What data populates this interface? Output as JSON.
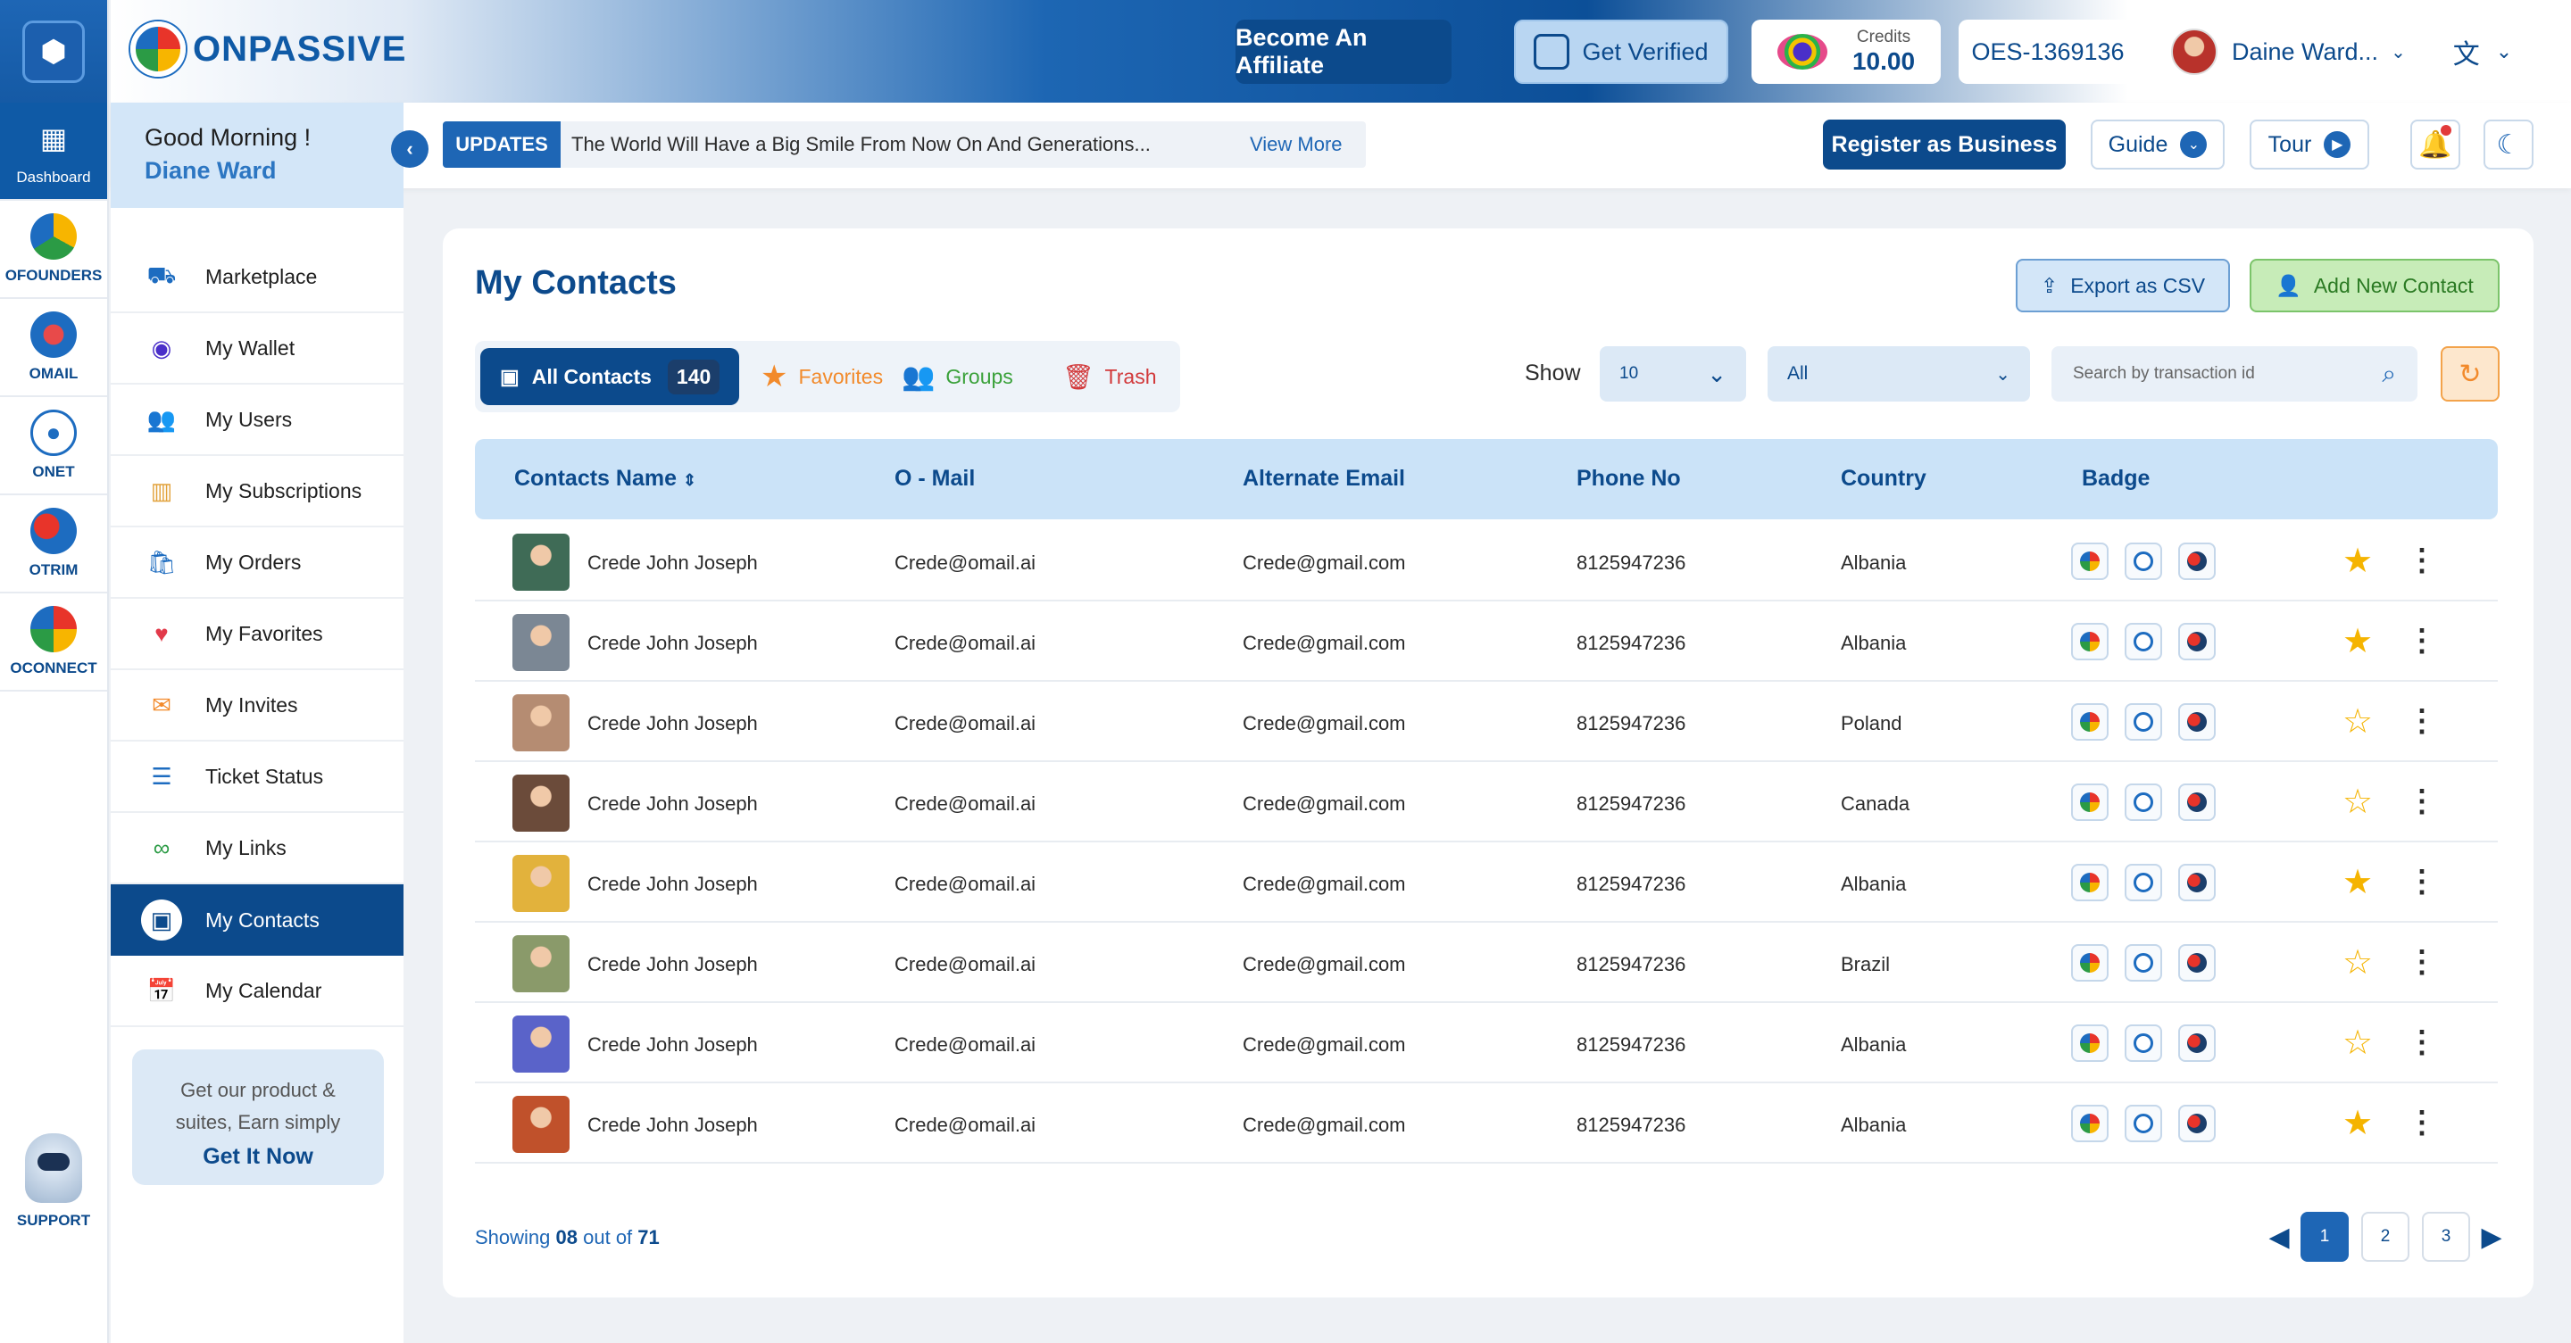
{
  "rail": {
    "items": [
      {
        "label": "Dashboard",
        "icon": "grid-icon"
      },
      {
        "label": "OFOUNDERS",
        "icon": "ofounders-icon"
      },
      {
        "label": "OMAIL",
        "icon": "omail-icon"
      },
      {
        "label": "ONET",
        "icon": "onet-icon"
      },
      {
        "label": "OTRIM",
        "icon": "otrim-icon"
      },
      {
        "label": "OCONNECT",
        "icon": "oconnect-icon"
      }
    ],
    "support": "SUPPORT"
  },
  "header": {
    "brand": "ONPASSIVE",
    "affiliate": "Become An Affiliate",
    "verified": "Get Verified",
    "credits_label": "Credits",
    "credits_value": "10.00",
    "oes_id": "OES-1369136",
    "user_name": "Daine Ward..."
  },
  "subbar": {
    "greeting": "Good Morning !",
    "name": "Diane Ward",
    "updates_tag": "UPDATES",
    "updates_text": "The World Will Have a Big Smile From Now On And Generations...",
    "view_more": "View More",
    "register": "Register as Business",
    "guide": "Guide",
    "tour": "Tour"
  },
  "sidebar": {
    "items": [
      "Marketplace",
      "My Wallet",
      "My Users",
      "My Subscriptions",
      "My Orders",
      "My Favorites",
      "My Invites",
      "Ticket Status",
      "My Links",
      "My Contacts",
      "My Calendar"
    ],
    "promo_text": "Get our product & suites, Earn simply",
    "promo_button": "Get It Now"
  },
  "main": {
    "title": "My Contacts",
    "export": "Export as CSV",
    "add": "Add New Contact",
    "tabs": {
      "all": "All Contacts",
      "count": "140",
      "favorites": "Favorites",
      "groups": "Groups",
      "trash": "Trash"
    },
    "show_label": "Show",
    "show_value": "10",
    "filter_value": "All",
    "search_placeholder": "Search by transaction id",
    "columns": [
      "Contacts Name",
      "O - Mail",
      "Alternate Email",
      "Phone No",
      "Country",
      "Badge"
    ],
    "rows": [
      {
        "name": "Crede John Joseph",
        "omail": "Crede@omail.ai",
        "alt": "Crede@gmail.com",
        "phone": "8125947236",
        "country": "Albania",
        "fav": true,
        "photo": "#3f6b56"
      },
      {
        "name": "Crede John Joseph",
        "omail": "Crede@omail.ai",
        "alt": "Crede@gmail.com",
        "phone": "8125947236",
        "country": "Albania",
        "fav": true,
        "photo": "#7b8794"
      },
      {
        "name": "Crede John Joseph",
        "omail": "Crede@omail.ai",
        "alt": "Crede@gmail.com",
        "phone": "8125947236",
        "country": "Poland",
        "fav": false,
        "photo": "#b58c72"
      },
      {
        "name": "Crede John Joseph",
        "omail": "Crede@omail.ai",
        "alt": "Crede@gmail.com",
        "phone": "8125947236",
        "country": "Canada",
        "fav": false,
        "photo": "#6b4b3a"
      },
      {
        "name": "Crede John Joseph",
        "omail": "Crede@omail.ai",
        "alt": "Crede@gmail.com",
        "phone": "8125947236",
        "country": "Albania",
        "fav": true,
        "photo": "#e2b23c"
      },
      {
        "name": "Crede John Joseph",
        "omail": "Crede@omail.ai",
        "alt": "Crede@gmail.com",
        "phone": "8125947236",
        "country": "Brazil",
        "fav": false,
        "photo": "#8a9a6a"
      },
      {
        "name": "Crede John Joseph",
        "omail": "Crede@omail.ai",
        "alt": "Crede@gmail.com",
        "phone": "8125947236",
        "country": "Albania",
        "fav": false,
        "photo": "#5a63c9"
      },
      {
        "name": "Crede John Joseph",
        "omail": "Crede@omail.ai",
        "alt": "Crede@gmail.com",
        "phone": "8125947236",
        "country": "Albania",
        "fav": true,
        "photo": "#c0512b"
      }
    ],
    "showing_prefix": "Showing",
    "showing_count": "08",
    "showing_mid": "out of",
    "showing_total": "71",
    "pages": [
      "1",
      "2",
      "3"
    ]
  },
  "colors": {
    "primary": "#0c4a8c",
    "accent": "#1e66b5",
    "star": "#f5b400",
    "header_bg": "#cbe3f8"
  }
}
